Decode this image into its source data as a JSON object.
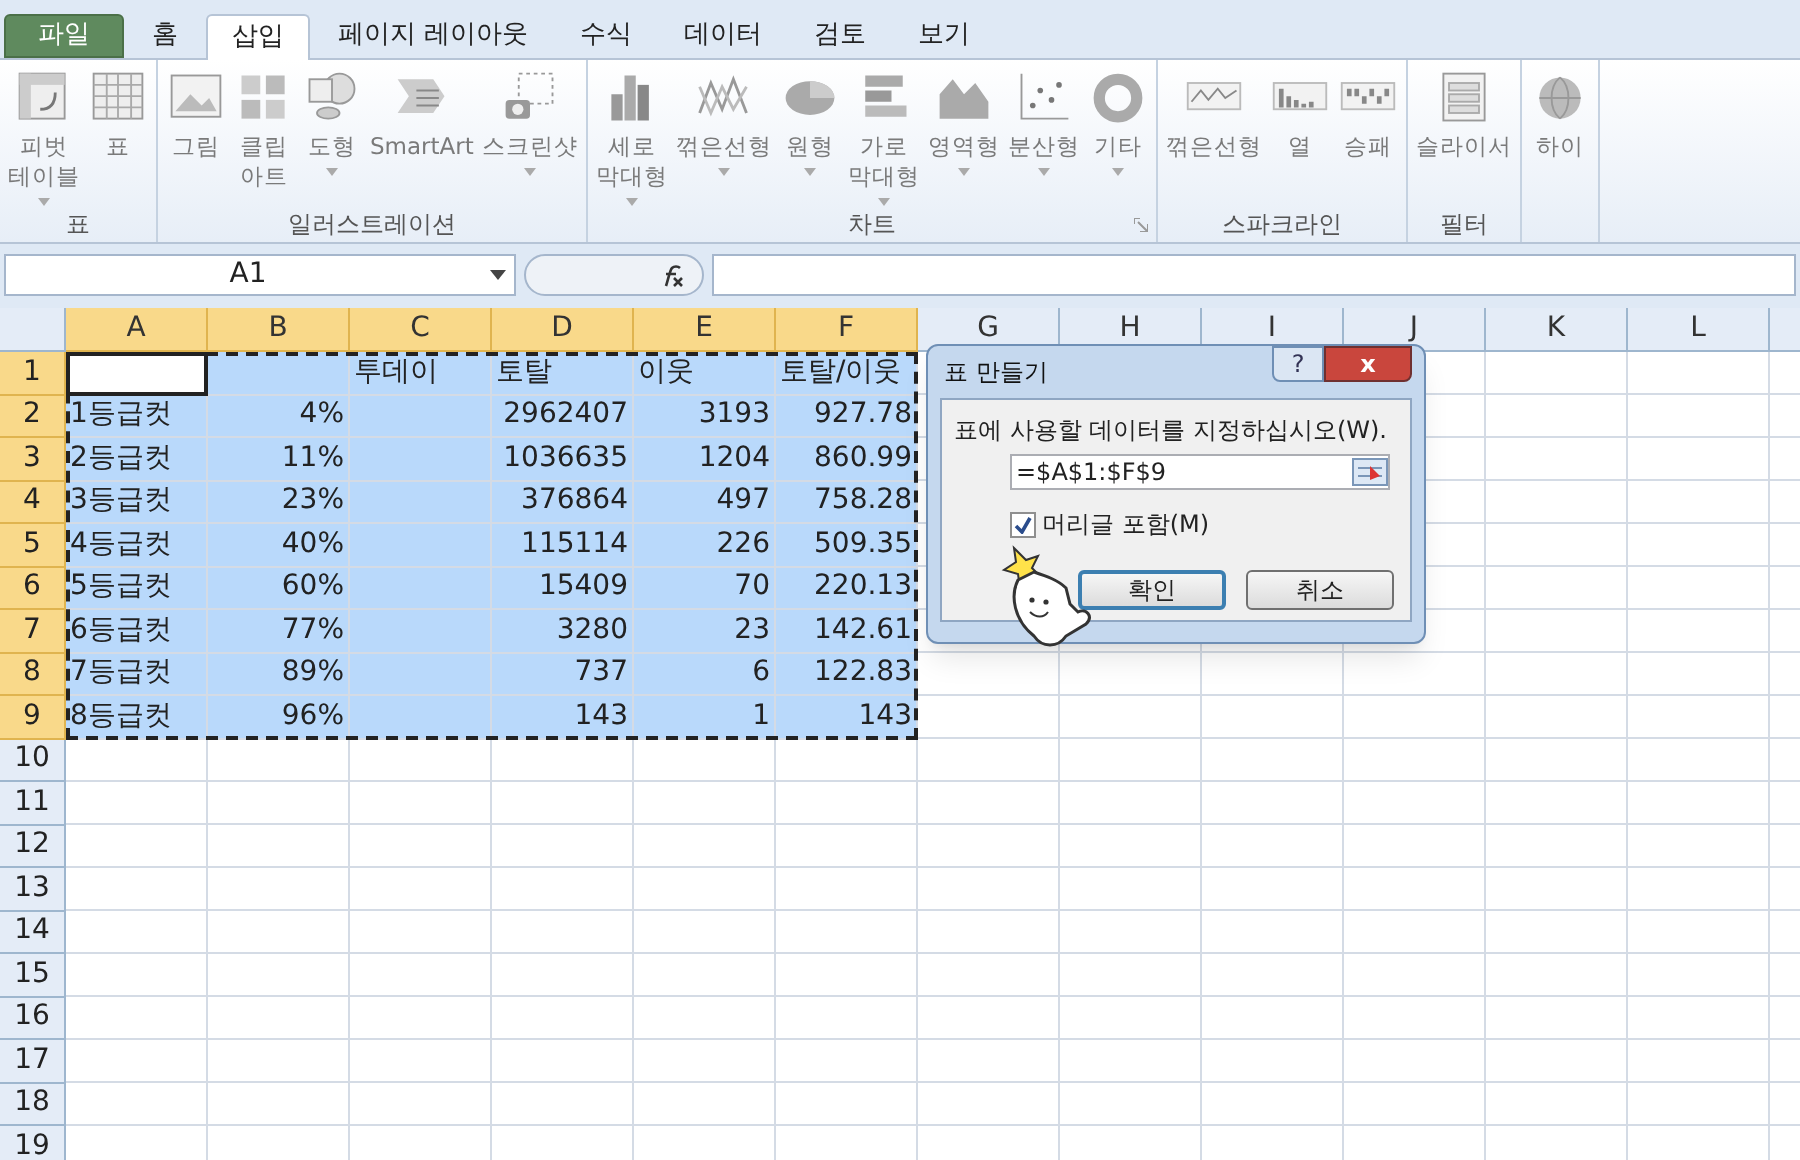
{
  "tabs": [
    {
      "label": "파일",
      "kind": "file",
      "selected": false
    },
    {
      "label": "홈",
      "kind": "tab",
      "selected": false
    },
    {
      "label": "삽입",
      "kind": "tab",
      "selected": true
    },
    {
      "label": "페이지 레이아웃",
      "kind": "tab",
      "selected": false
    },
    {
      "label": "수식",
      "kind": "tab",
      "selected": false
    },
    {
      "label": "데이터",
      "kind": "tab",
      "selected": false
    },
    {
      "label": "검토",
      "kind": "tab",
      "selected": false
    },
    {
      "label": "보기",
      "kind": "tab",
      "selected": false
    }
  ],
  "ribbon": {
    "groups": [
      {
        "label": "표",
        "launcher": false,
        "buttons": [
          {
            "label": "피벗\n테이블",
            "dropdown": true
          },
          {
            "label": "표",
            "dropdown": false
          }
        ]
      },
      {
        "label": "일러스트레이션",
        "launcher": false,
        "buttons": [
          {
            "label": "그림",
            "dropdown": false
          },
          {
            "label": "클립\n아트",
            "dropdown": false
          },
          {
            "label": "도형",
            "dropdown": true
          },
          {
            "label": "SmartArt",
            "dropdown": false
          },
          {
            "label": "스크린샷",
            "dropdown": true
          }
        ]
      },
      {
        "label": "차트",
        "launcher": true,
        "buttons": [
          {
            "label": "세로\n막대형",
            "dropdown": true
          },
          {
            "label": "꺾은선형",
            "dropdown": true
          },
          {
            "label": "원형",
            "dropdown": true
          },
          {
            "label": "가로\n막대형",
            "dropdown": true
          },
          {
            "label": "영역형",
            "dropdown": true
          },
          {
            "label": "분산형",
            "dropdown": true
          },
          {
            "label": "기타",
            "dropdown": true
          }
        ]
      },
      {
        "label": "스파크라인",
        "launcher": false,
        "buttons": [
          {
            "label": "꺾은선형",
            "dropdown": false
          },
          {
            "label": "열",
            "dropdown": false
          },
          {
            "label": "승패",
            "dropdown": false
          }
        ]
      },
      {
        "label": "필터",
        "launcher": false,
        "buttons": [
          {
            "label": "슬라이서",
            "dropdown": false
          }
        ]
      },
      {
        "launcher": false,
        "buttons": [
          {
            "label": "하이",
            "dropdown": false
          }
        ]
      }
    ]
  },
  "formula_bar": {
    "name_box": "A1"
  },
  "sheet": {
    "columns": [
      {
        "label": "A",
        "selected": true
      },
      {
        "label": "B",
        "selected": true
      },
      {
        "label": "C",
        "selected": true
      },
      {
        "label": "D",
        "selected": true
      },
      {
        "label": "E",
        "selected": true
      },
      {
        "label": "F",
        "selected": true
      },
      {
        "label": "G",
        "selected": false
      },
      {
        "label": "H",
        "selected": false
      },
      {
        "label": "I",
        "selected": false
      },
      {
        "label": "J",
        "selected": false
      },
      {
        "label": "K",
        "selected": false
      },
      {
        "label": "L",
        "selected": false
      }
    ],
    "rows": [
      {
        "header": "1",
        "selected": true,
        "kind": "header",
        "active_first_cell": true,
        "cells": [
          null,
          null,
          "투데이",
          "토탈",
          "이웃",
          "토탈/이웃"
        ]
      },
      {
        "header": "2",
        "selected": true,
        "kind": "data",
        "active_first_cell": false,
        "cells": [
          "1등급컷",
          "4%",
          null,
          "2962407",
          "3193",
          "927.78"
        ]
      },
      {
        "header": "3",
        "selected": true,
        "kind": "data",
        "active_first_cell": false,
        "cells": [
          "2등급컷",
          "11%",
          null,
          "1036635",
          "1204",
          "860.99"
        ]
      },
      {
        "header": "4",
        "selected": true,
        "kind": "data",
        "active_first_cell": false,
        "cells": [
          "3등급컷",
          "23%",
          null,
          "376864",
          "497",
          "758.28"
        ]
      },
      {
        "header": "5",
        "selected": true,
        "kind": "data",
        "active_first_cell": false,
        "cells": [
          "4등급컷",
          "40%",
          null,
          "115114",
          "226",
          "509.35"
        ]
      },
      {
        "header": "6",
        "selected": true,
        "kind": "data",
        "active_first_cell": false,
        "cells": [
          "5등급컷",
          "60%",
          null,
          "15409",
          "70",
          "220.13"
        ]
      },
      {
        "header": "7",
        "selected": true,
        "kind": "data",
        "active_first_cell": false,
        "cells": [
          "6등급컷",
          "77%",
          null,
          "3280",
          "23",
          "142.61"
        ]
      },
      {
        "header": "8",
        "selected": true,
        "kind": "data",
        "active_first_cell": false,
        "cells": [
          "7등급컷",
          "89%",
          null,
          "737",
          "6",
          "122.83"
        ]
      },
      {
        "header": "9",
        "selected": true,
        "kind": "data",
        "active_first_cell": false,
        "cells": [
          "8등급컷",
          "96%",
          null,
          "143",
          "1",
          "143"
        ]
      },
      {
        "header": "10",
        "selected": false,
        "kind": "data",
        "active_first_cell": false,
        "cells": []
      },
      {
        "header": "11",
        "selected": false,
        "kind": "data",
        "active_first_cell": false,
        "cells": []
      },
      {
        "header": "12",
        "selected": false,
        "kind": "data",
        "active_first_cell": false,
        "cells": []
      },
      {
        "header": "13",
        "selected": false,
        "kind": "data",
        "active_first_cell": false,
        "cells": []
      },
      {
        "header": "14",
        "selected": false,
        "kind": "data",
        "active_first_cell": false,
        "cells": []
      },
      {
        "header": "15",
        "selected": false,
        "kind": "data",
        "active_first_cell": false,
        "cells": []
      },
      {
        "header": "16",
        "selected": false,
        "kind": "data",
        "active_first_cell": false,
        "cells": []
      },
      {
        "header": "17",
        "selected": false,
        "kind": "data",
        "active_first_cell": false,
        "cells": []
      },
      {
        "header": "18",
        "selected": false,
        "kind": "data",
        "active_first_cell": false,
        "cells": []
      },
      {
        "header": "19",
        "selected": false,
        "kind": "data",
        "active_first_cell": false,
        "cells": []
      }
    ]
  },
  "dialog": {
    "title": "표 만들기",
    "help": "?",
    "close": "x",
    "prompt": "표에 사용할 데이터를 지정하십시오(W).",
    "range": "=$A$1:$F$9",
    "checkbox": {
      "label": "머리글 포함(M)",
      "checked": true
    },
    "buttons": [
      {
        "label": "확인",
        "default": true
      },
      {
        "label": "취소",
        "default": false
      }
    ]
  }
}
